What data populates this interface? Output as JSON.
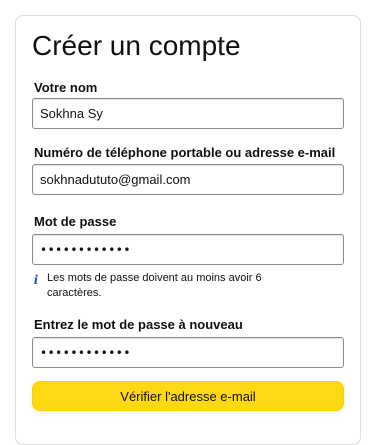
{
  "form": {
    "title": "Créer un compte",
    "name": {
      "label": "Votre nom",
      "value": "Sokhna Sy"
    },
    "contact": {
      "label": "Numéro de téléphone portable ou adresse e-mail",
      "value": "sokhnadututo@gmail.com"
    },
    "password": {
      "label": "Mot de passe",
      "value": "••••••••••••"
    },
    "password_hint": {
      "icon": "info-icon",
      "icon_glyph": "i",
      "text": "Les mots de passe doivent au moins avoir 6 caractères."
    },
    "password_confirm": {
      "label": "Entrez le mot de passe à nouveau",
      "value": "••••••••••••"
    },
    "verify_button_label": "Vérifier l'adresse e-mail"
  },
  "colors": {
    "button_bg": "#ffd814",
    "button_border": "#fcd200",
    "info_icon": "#2162a1",
    "text": "#0f1111",
    "field_border": "#888c8c"
  }
}
